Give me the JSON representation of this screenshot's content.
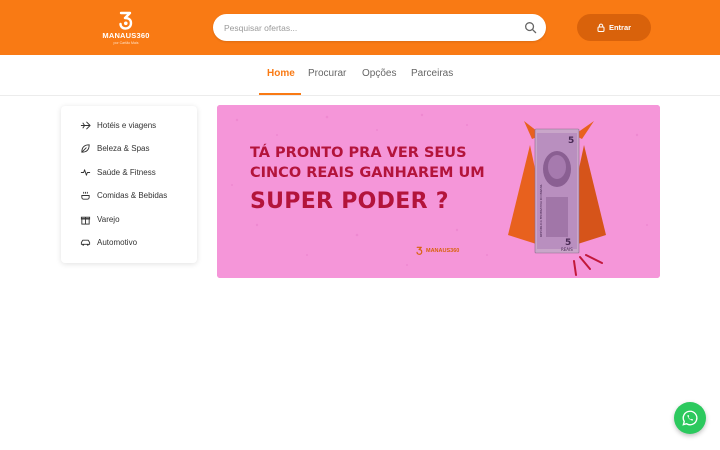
{
  "header": {
    "logo_text": "MANAUS360",
    "logo_subtext": "por Cartão Mais",
    "search_placeholder": "Pesquisar ofertas...",
    "login_label": "Entrar"
  },
  "nav": {
    "items": [
      {
        "label": "Home",
        "active": true
      },
      {
        "label": "Procurar",
        "active": false
      },
      {
        "label": "Opções",
        "active": false
      },
      {
        "label": "Parceiras",
        "active": false
      }
    ]
  },
  "sidebar": {
    "categories": [
      {
        "label": "Hotéis e viagens",
        "icon": "plane-icon"
      },
      {
        "label": "Beleza & Spas",
        "icon": "leaf-icon"
      },
      {
        "label": "Saúde & Fitness",
        "icon": "heartbeat-icon"
      },
      {
        "label": "Comidas & Bebidas",
        "icon": "food-icon"
      },
      {
        "label": "Varejo",
        "icon": "gift-icon"
      },
      {
        "label": "Automotivo",
        "icon": "car-icon"
      }
    ]
  },
  "banner": {
    "line1": "TÁ PRONTO PRA VER SEUS",
    "line2": "CINCO REAIS GANHAREM UM",
    "line3": "SUPER PODER ?",
    "logo_text": "MANAUS360",
    "bill_value": "5",
    "bill_label": "REAIS",
    "bill_country": "REPÚBLICA FEDERATIVA DO BRASIL",
    "background_color": "#f596d9",
    "headline_color": "#b3143b"
  },
  "colors": {
    "brand_orange": "#f97a14",
    "button_orange": "#d9620b",
    "whatsapp_green": "#2cc95e"
  },
  "whatsapp": {
    "icon": "whatsapp-icon"
  }
}
